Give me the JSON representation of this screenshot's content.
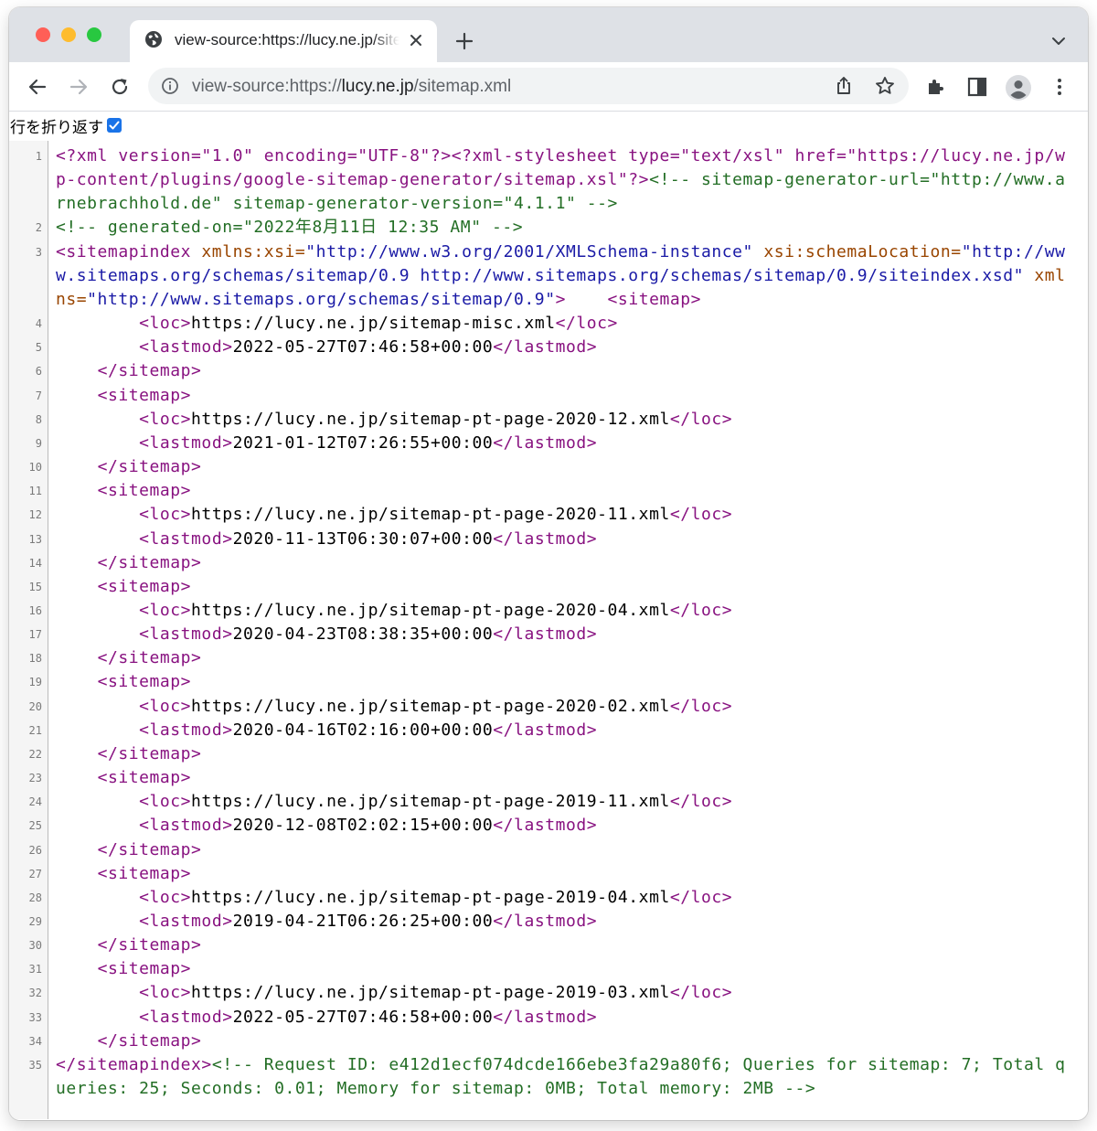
{
  "browser": {
    "tab": {
      "title": "view-source:https://lucy.ne.jp/sitemap.xml"
    },
    "omnibox": {
      "scheme": "view-source:https://",
      "host": "lucy.ne.jp",
      "path": "/sitemap.xml"
    },
    "icons": [
      "back-icon",
      "forward-icon",
      "reload-icon",
      "info-icon",
      "share-icon",
      "star-icon",
      "extensions-icon",
      "side-panel-icon",
      "profile-icon",
      "menu-icon",
      "globe-icon",
      "close-icon",
      "plus-icon",
      "chevron-down-icon"
    ]
  },
  "colors": {
    "tag": "#881280",
    "attribute": "#994500",
    "value": "#1a1aa6",
    "comment": "#236e25",
    "accent": "#1a73e8"
  },
  "viewer": {
    "wrap_label": "行を折り返す",
    "wrap_checked": true
  },
  "source": {
    "lines": [
      {
        "n": "1",
        "segs": [
          {
            "c": "tag",
            "t": "<?xml version=\"1.0\" encoding=\"UTF-8\"?><?xml-stylesheet type=\"text/xsl\" href=\"https://lucy.ne.jp/wp-content/plugins/google-sitemap-generator/sitemap.xsl\"?>"
          },
          {
            "c": "cmt",
            "t": "<!-- sitemap-generator-url=\"http://www.arnebrachhold.de\" sitemap-generator-version=\"4.1.1\" -->"
          }
        ]
      },
      {
        "n": "2",
        "segs": [
          {
            "c": "cmt",
            "t": "<!-- generated-on=\"2022年8月11日 12:35 AM\" -->"
          }
        ]
      },
      {
        "n": "3",
        "segs": [
          {
            "c": "tag",
            "t": "<sitemapindex "
          },
          {
            "c": "attr",
            "t": "xmlns:xsi="
          },
          {
            "c": "val",
            "t": "\"http://www.w3.org/2001/XMLSchema-instance\""
          },
          {
            "c": "tag",
            "t": " "
          },
          {
            "c": "attr",
            "t": "xsi:schemaLocation="
          },
          {
            "c": "val",
            "t": "\"http://www.sitemaps.org/schemas/sitemap/0.9 http://www.sitemaps.org/schemas/sitemap/0.9/siteindex.xsd\""
          },
          {
            "c": "tag",
            "t": " "
          },
          {
            "c": "attr",
            "t": "xmlns="
          },
          {
            "c": "val",
            "t": "\"http://www.sitemaps.org/schemas/sitemap/0.9\""
          },
          {
            "c": "tag",
            "t": ">"
          },
          {
            "c": "txt",
            "t": "    "
          },
          {
            "c": "tag",
            "t": "<sitemap>"
          }
        ]
      },
      {
        "n": "4",
        "segs": [
          {
            "c": "txt",
            "t": "        "
          },
          {
            "c": "tag",
            "t": "<loc>"
          },
          {
            "c": "txt",
            "t": "https://lucy.ne.jp/sitemap-misc.xml"
          },
          {
            "c": "tag",
            "t": "</loc>"
          }
        ]
      },
      {
        "n": "5",
        "segs": [
          {
            "c": "txt",
            "t": "        "
          },
          {
            "c": "tag",
            "t": "<lastmod>"
          },
          {
            "c": "txt",
            "t": "2022-05-27T07:46:58+00:00"
          },
          {
            "c": "tag",
            "t": "</lastmod>"
          }
        ]
      },
      {
        "n": "6",
        "segs": [
          {
            "c": "txt",
            "t": "    "
          },
          {
            "c": "tag",
            "t": "</sitemap>"
          }
        ]
      },
      {
        "n": "7",
        "segs": [
          {
            "c": "txt",
            "t": "    "
          },
          {
            "c": "tag",
            "t": "<sitemap>"
          }
        ]
      },
      {
        "n": "8",
        "segs": [
          {
            "c": "txt",
            "t": "        "
          },
          {
            "c": "tag",
            "t": "<loc>"
          },
          {
            "c": "txt",
            "t": "https://lucy.ne.jp/sitemap-pt-page-2020-12.xml"
          },
          {
            "c": "tag",
            "t": "</loc>"
          }
        ]
      },
      {
        "n": "9",
        "segs": [
          {
            "c": "txt",
            "t": "        "
          },
          {
            "c": "tag",
            "t": "<lastmod>"
          },
          {
            "c": "txt",
            "t": "2021-01-12T07:26:55+00:00"
          },
          {
            "c": "tag",
            "t": "</lastmod>"
          }
        ]
      },
      {
        "n": "10",
        "segs": [
          {
            "c": "txt",
            "t": "    "
          },
          {
            "c": "tag",
            "t": "</sitemap>"
          }
        ]
      },
      {
        "n": "11",
        "segs": [
          {
            "c": "txt",
            "t": "    "
          },
          {
            "c": "tag",
            "t": "<sitemap>"
          }
        ]
      },
      {
        "n": "12",
        "segs": [
          {
            "c": "txt",
            "t": "        "
          },
          {
            "c": "tag",
            "t": "<loc>"
          },
          {
            "c": "txt",
            "t": "https://lucy.ne.jp/sitemap-pt-page-2020-11.xml"
          },
          {
            "c": "tag",
            "t": "</loc>"
          }
        ]
      },
      {
        "n": "13",
        "segs": [
          {
            "c": "txt",
            "t": "        "
          },
          {
            "c": "tag",
            "t": "<lastmod>"
          },
          {
            "c": "txt",
            "t": "2020-11-13T06:30:07+00:00"
          },
          {
            "c": "tag",
            "t": "</lastmod>"
          }
        ]
      },
      {
        "n": "14",
        "segs": [
          {
            "c": "txt",
            "t": "    "
          },
          {
            "c": "tag",
            "t": "</sitemap>"
          }
        ]
      },
      {
        "n": "15",
        "segs": [
          {
            "c": "txt",
            "t": "    "
          },
          {
            "c": "tag",
            "t": "<sitemap>"
          }
        ]
      },
      {
        "n": "16",
        "segs": [
          {
            "c": "txt",
            "t": "        "
          },
          {
            "c": "tag",
            "t": "<loc>"
          },
          {
            "c": "txt",
            "t": "https://lucy.ne.jp/sitemap-pt-page-2020-04.xml"
          },
          {
            "c": "tag",
            "t": "</loc>"
          }
        ]
      },
      {
        "n": "17",
        "segs": [
          {
            "c": "txt",
            "t": "        "
          },
          {
            "c": "tag",
            "t": "<lastmod>"
          },
          {
            "c": "txt",
            "t": "2020-04-23T08:38:35+00:00"
          },
          {
            "c": "tag",
            "t": "</lastmod>"
          }
        ]
      },
      {
        "n": "18",
        "segs": [
          {
            "c": "txt",
            "t": "    "
          },
          {
            "c": "tag",
            "t": "</sitemap>"
          }
        ]
      },
      {
        "n": "19",
        "segs": [
          {
            "c": "txt",
            "t": "    "
          },
          {
            "c": "tag",
            "t": "<sitemap>"
          }
        ]
      },
      {
        "n": "20",
        "segs": [
          {
            "c": "txt",
            "t": "        "
          },
          {
            "c": "tag",
            "t": "<loc>"
          },
          {
            "c": "txt",
            "t": "https://lucy.ne.jp/sitemap-pt-page-2020-02.xml"
          },
          {
            "c": "tag",
            "t": "</loc>"
          }
        ]
      },
      {
        "n": "21",
        "segs": [
          {
            "c": "txt",
            "t": "        "
          },
          {
            "c": "tag",
            "t": "<lastmod>"
          },
          {
            "c": "txt",
            "t": "2020-04-16T02:16:00+00:00"
          },
          {
            "c": "tag",
            "t": "</lastmod>"
          }
        ]
      },
      {
        "n": "22",
        "segs": [
          {
            "c": "txt",
            "t": "    "
          },
          {
            "c": "tag",
            "t": "</sitemap>"
          }
        ]
      },
      {
        "n": "23",
        "segs": [
          {
            "c": "txt",
            "t": "    "
          },
          {
            "c": "tag",
            "t": "<sitemap>"
          }
        ]
      },
      {
        "n": "24",
        "segs": [
          {
            "c": "txt",
            "t": "        "
          },
          {
            "c": "tag",
            "t": "<loc>"
          },
          {
            "c": "txt",
            "t": "https://lucy.ne.jp/sitemap-pt-page-2019-11.xml"
          },
          {
            "c": "tag",
            "t": "</loc>"
          }
        ]
      },
      {
        "n": "25",
        "segs": [
          {
            "c": "txt",
            "t": "        "
          },
          {
            "c": "tag",
            "t": "<lastmod>"
          },
          {
            "c": "txt",
            "t": "2020-12-08T02:02:15+00:00"
          },
          {
            "c": "tag",
            "t": "</lastmod>"
          }
        ]
      },
      {
        "n": "26",
        "segs": [
          {
            "c": "txt",
            "t": "    "
          },
          {
            "c": "tag",
            "t": "</sitemap>"
          }
        ]
      },
      {
        "n": "27",
        "segs": [
          {
            "c": "txt",
            "t": "    "
          },
          {
            "c": "tag",
            "t": "<sitemap>"
          }
        ]
      },
      {
        "n": "28",
        "segs": [
          {
            "c": "txt",
            "t": "        "
          },
          {
            "c": "tag",
            "t": "<loc>"
          },
          {
            "c": "txt",
            "t": "https://lucy.ne.jp/sitemap-pt-page-2019-04.xml"
          },
          {
            "c": "tag",
            "t": "</loc>"
          }
        ]
      },
      {
        "n": "29",
        "segs": [
          {
            "c": "txt",
            "t": "        "
          },
          {
            "c": "tag",
            "t": "<lastmod>"
          },
          {
            "c": "txt",
            "t": "2019-04-21T06:26:25+00:00"
          },
          {
            "c": "tag",
            "t": "</lastmod>"
          }
        ]
      },
      {
        "n": "30",
        "segs": [
          {
            "c": "txt",
            "t": "    "
          },
          {
            "c": "tag",
            "t": "</sitemap>"
          }
        ]
      },
      {
        "n": "31",
        "segs": [
          {
            "c": "txt",
            "t": "    "
          },
          {
            "c": "tag",
            "t": "<sitemap>"
          }
        ]
      },
      {
        "n": "32",
        "segs": [
          {
            "c": "txt",
            "t": "        "
          },
          {
            "c": "tag",
            "t": "<loc>"
          },
          {
            "c": "txt",
            "t": "https://lucy.ne.jp/sitemap-pt-page-2019-03.xml"
          },
          {
            "c": "tag",
            "t": "</loc>"
          }
        ]
      },
      {
        "n": "33",
        "segs": [
          {
            "c": "txt",
            "t": "        "
          },
          {
            "c": "tag",
            "t": "<lastmod>"
          },
          {
            "c": "txt",
            "t": "2022-05-27T07:46:58+00:00"
          },
          {
            "c": "tag",
            "t": "</lastmod>"
          }
        ]
      },
      {
        "n": "34",
        "segs": [
          {
            "c": "txt",
            "t": "    "
          },
          {
            "c": "tag",
            "t": "</sitemap>"
          }
        ]
      },
      {
        "n": "35",
        "segs": [
          {
            "c": "tag",
            "t": "</sitemapindex>"
          },
          {
            "c": "cmt",
            "t": "<!-- Request ID: e412d1ecf074dcde166ebe3fa29a80f6; Queries for sitemap: 7; Total queries: 25; Seconds: 0.01; Memory for sitemap: 0MB; Total memory: 2MB -->"
          }
        ]
      }
    ]
  }
}
